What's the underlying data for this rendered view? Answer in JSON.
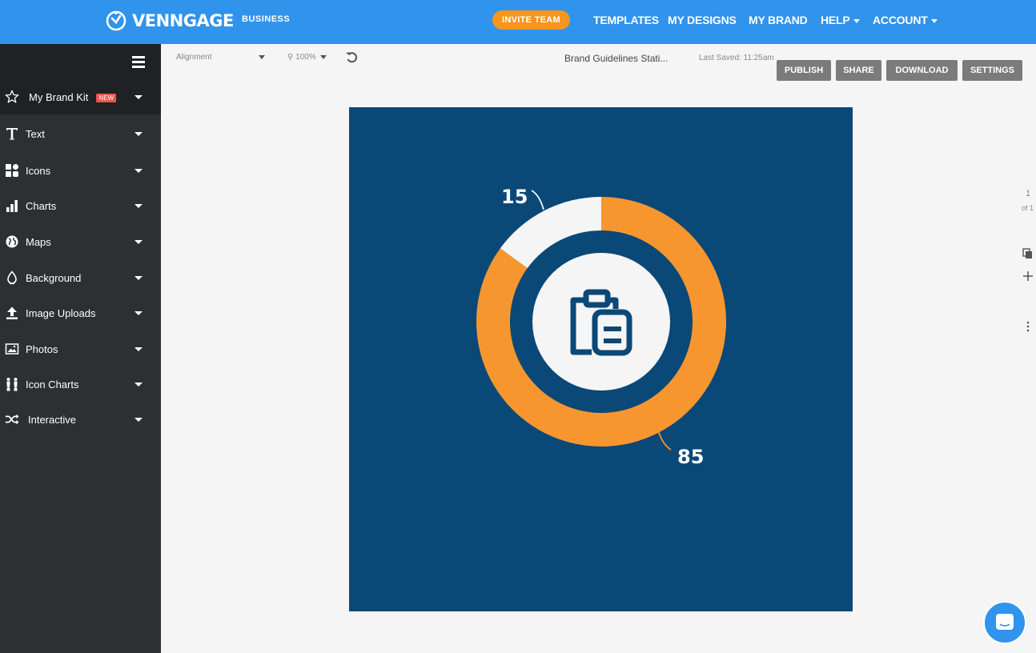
{
  "header": {
    "brand": "VENNGAGE",
    "plan": "BUSINESS",
    "invite_label": "INVITE TEAM",
    "nav": [
      "TEMPLATES",
      "MY DESIGNS",
      "MY BRAND",
      "HELP",
      "ACCOUNT"
    ],
    "colors": {
      "bar": "#3093ec",
      "invite": "#f7951d"
    }
  },
  "sidebar": {
    "items": [
      {
        "label": "My Brand Kit",
        "icon": "star-icon",
        "badge": "NEW"
      },
      {
        "label": "Text",
        "icon": "text-icon"
      },
      {
        "label": "Icons",
        "icon": "shapes-icon"
      },
      {
        "label": "Charts",
        "icon": "bar-chart-icon"
      },
      {
        "label": "Maps",
        "icon": "globe-icon"
      },
      {
        "label": "Background",
        "icon": "bucket-icon"
      },
      {
        "label": "Image Uploads",
        "icon": "upload-icon"
      },
      {
        "label": "Photos",
        "icon": "image-icon"
      },
      {
        "label": "Icon Charts",
        "icon": "people-icon"
      },
      {
        "label": "Interactive",
        "icon": "shuffle-icon"
      }
    ]
  },
  "toolbar": {
    "alignment": "Alignment",
    "zoom": "100%",
    "doc_title": "Brand Guidelines Stati...",
    "last_saved": "Last Saved: 11:25am",
    "buttons": [
      "PUBLISH",
      "SHARE",
      "DOWNLOAD",
      "SETTINGS"
    ]
  },
  "canvas": {
    "background": "#0a4877",
    "center_icon": "clipboard-icon",
    "chart_data": {
      "type": "pie",
      "categories": [
        "",
        ""
      ],
      "values": [
        85,
        15
      ],
      "colors": [
        "#f7962f",
        "#f5f5f5"
      ],
      "data_labels": [
        "85",
        "15"
      ]
    }
  },
  "pager": {
    "page": "1",
    "of": "of 1"
  }
}
